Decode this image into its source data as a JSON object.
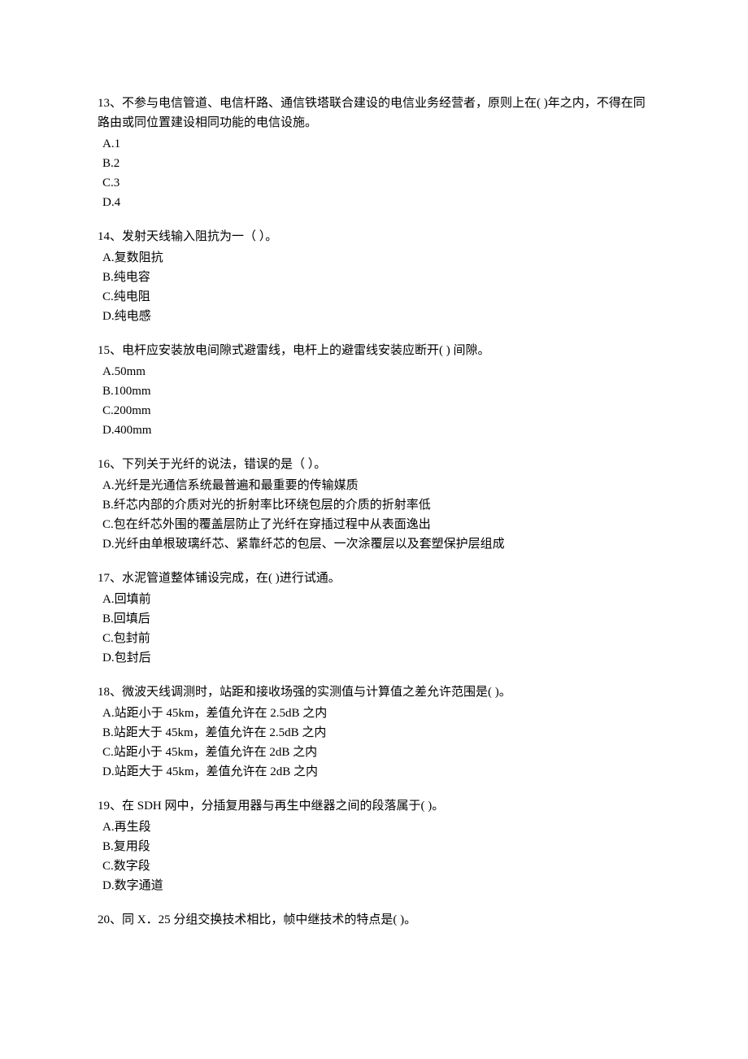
{
  "questions": [
    {
      "number": "13",
      "stem": "13、不参与电信管道、电信杆路、通信铁塔联合建设的电信业务经营者，原则上在( )年之内，不得在同路由或同位置建设相同功能的电信设施。",
      "options": [
        "A.1",
        "B.2",
        "C.3",
        "D.4"
      ]
    },
    {
      "number": "14",
      "stem": "14、发射天线输入阻抗为一（   ）。",
      "options": [
        "A.复数阻抗",
        "B.纯电容",
        "C.纯电阻",
        "D.纯电感"
      ]
    },
    {
      "number": "15",
      "stem": "15、电杆应安装放电间隙式避雷线，电杆上的避雷线安装应断开( ) 间隙。",
      "options": [
        "A.50mm",
        "B.100mm",
        "C.200mm",
        "D.400mm"
      ]
    },
    {
      "number": "16",
      "stem": "16、下列关于光纤的说法，错误的是（ ）。",
      "options": [
        "A.光纤是光通信系统最普遍和最重要的传输媒质",
        "B.纤芯内部的介质对光的折射率比环绕包层的介质的折射率低",
        "C.包在纤芯外围的覆盖层防止了光纤在穿插过程中从表面逸出",
        "D.光纤由单根玻璃纤芯、紧靠纤芯的包层、一次涂覆层以及套塑保护层组成"
      ]
    },
    {
      "number": "17",
      "stem": "17、水泥管道整体铺设完成，在( )进行试通。",
      "options": [
        "A.回填前",
        "B.回填后",
        "C.包封前",
        "D.包封后"
      ]
    },
    {
      "number": "18",
      "stem": "18、微波天线调测时，站距和接收场强的实测值与计算值之差允许范围是( )。",
      "options": [
        "A.站距小于 45km，差值允许在 2.5dB 之内",
        "B.站距大于 45km，差值允许在 2.5dB 之内",
        "C.站距小于 45km，差值允许在 2dB 之内",
        "D.站距大于 45km，差值允许在 2dB 之内"
      ]
    },
    {
      "number": "19",
      "stem": "19、在 SDH 网中，分插复用器与再生中继器之间的段落属于( )。",
      "options": [
        "A.再生段",
        "B.复用段",
        "C.数字段",
        "D.数字通道"
      ]
    },
    {
      "number": "20",
      "stem": "20、同 X．25 分组交换技术相比，帧中继技术的特点是( )。",
      "options": []
    }
  ]
}
